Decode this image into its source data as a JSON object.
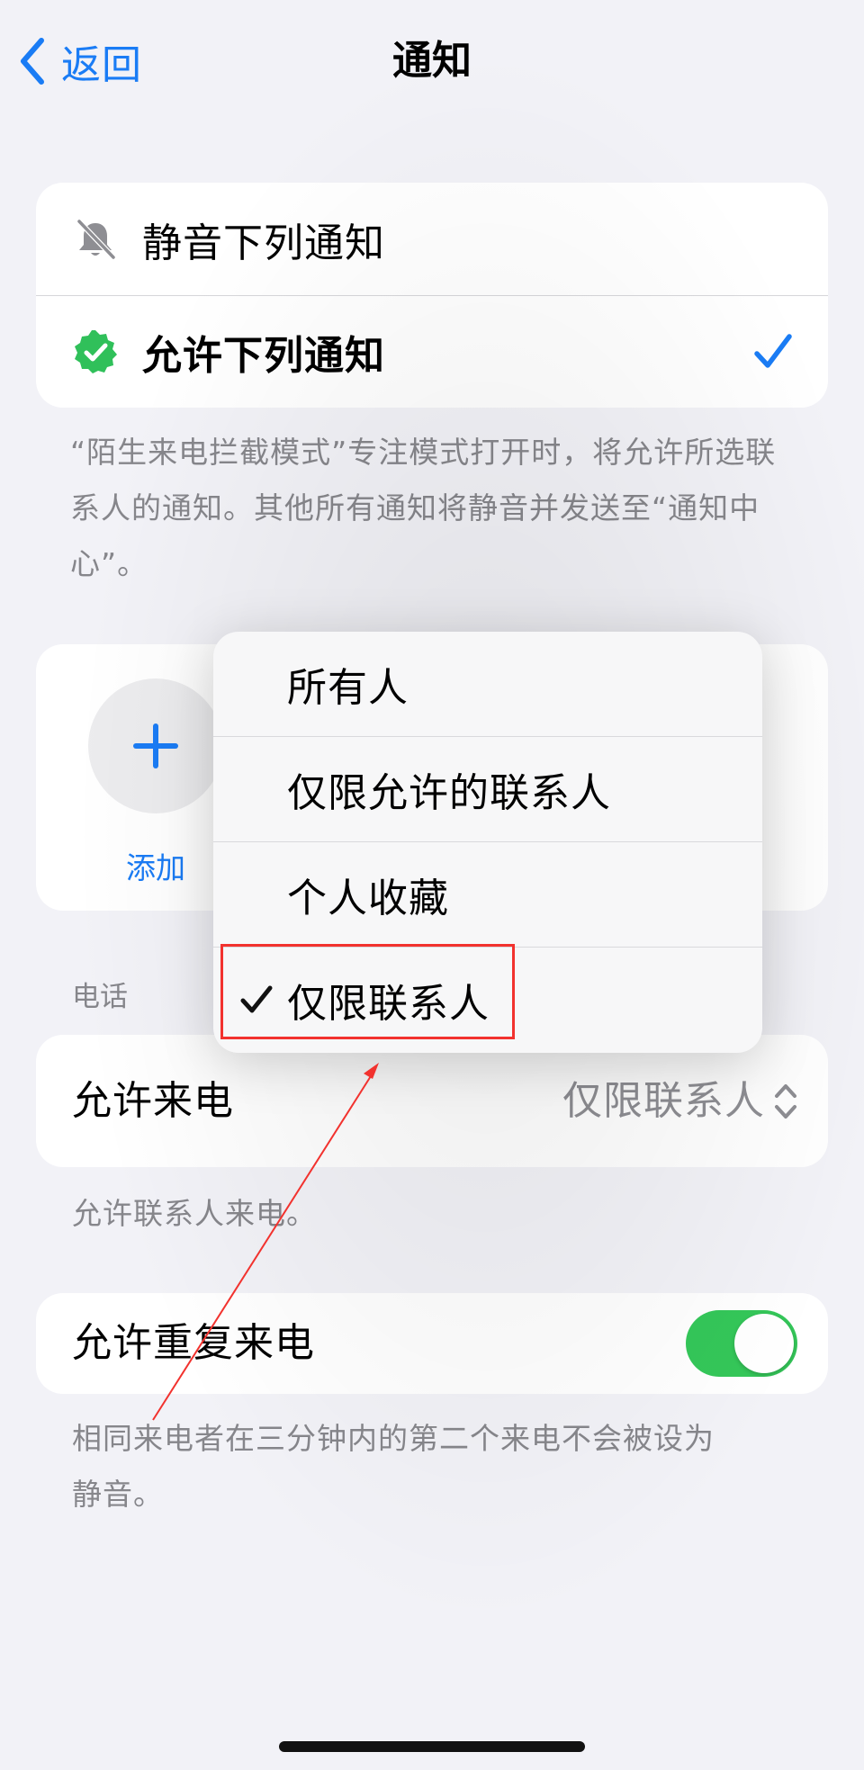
{
  "nav": {
    "back_label": "返回",
    "title": "通知"
  },
  "notify_mode": {
    "mute_label": "静音下列通知",
    "allow_label": "允许下列通知",
    "selected": "allow"
  },
  "notify_footnote": "“陌生来电拦截模式”专注模式打开时，将允许所选联系人的通知。其他所有通知将静音并发送至“通知中心”。",
  "people": {
    "add_label": "添加"
  },
  "phone_section": {
    "header": "电话"
  },
  "allow_calls": {
    "label": "允许来电",
    "value": "仅限联系人",
    "footnote": "允许联系人来电。"
  },
  "repeat_calls": {
    "label": "允许重复来电",
    "on": true,
    "footnote": "相同来电者在三分钟内的第二个来电不会被设为静音。"
  },
  "menu": {
    "items": [
      {
        "label": "所有人",
        "checked": false
      },
      {
        "label": "仅限允许的联系人",
        "checked": false
      },
      {
        "label": "个人收藏",
        "checked": false
      },
      {
        "label": "仅限联系人",
        "checked": true
      }
    ]
  },
  "colors": {
    "accent": "#1a7cf5",
    "toggle_on": "#34c759",
    "badge_green": "#30c05a",
    "annotation_red": "#f2322e"
  }
}
